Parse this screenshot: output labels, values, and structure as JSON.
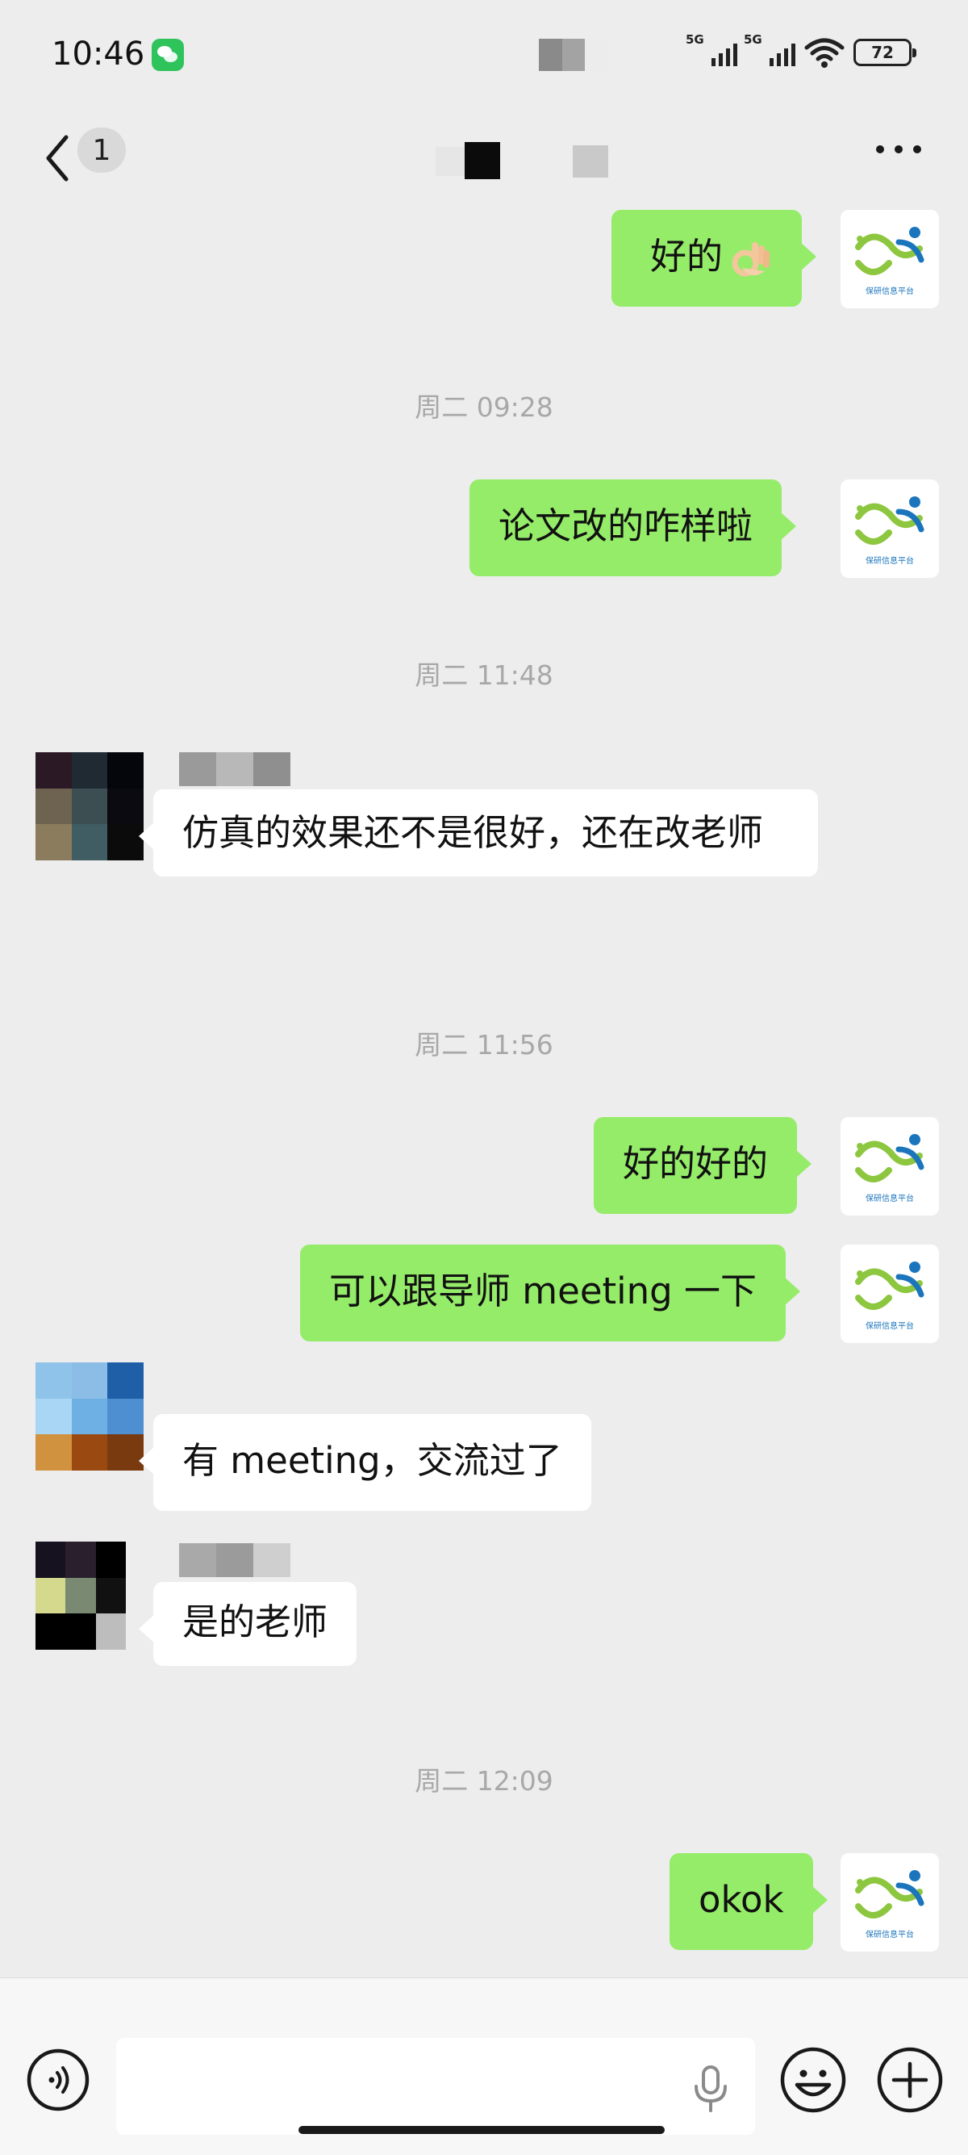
{
  "status_bar": {
    "time": "10:46",
    "signal_1": "5G",
    "signal_2": "5G",
    "battery": "72"
  },
  "nav": {
    "unread_count": "1"
  },
  "messages": [
    {
      "type": "outgoing",
      "text": "好的",
      "emoji": "ok-hand"
    },
    {
      "type": "time",
      "text": "周二 09:28"
    },
    {
      "type": "outgoing",
      "text": "论文改的咋样啦"
    },
    {
      "type": "time",
      "text": "周二 11:48"
    },
    {
      "type": "incoming",
      "text": "仿真的效果还不是很好，还在改老师"
    },
    {
      "type": "time",
      "text": "周二 11:56"
    },
    {
      "type": "outgoing",
      "text": "好的好的"
    },
    {
      "type": "outgoing",
      "text": "可以跟导师 meeting 一下"
    },
    {
      "type": "incoming",
      "text": "有 meeting，交流过了"
    },
    {
      "type": "incoming",
      "text": "是的老师"
    },
    {
      "type": "time",
      "text": "周二 12:09"
    },
    {
      "type": "outgoing",
      "text": "okok"
    }
  ],
  "self_avatar": {
    "caption": "保研信息平台",
    "colors": {
      "green": "#8dc63f",
      "blue": "#1b75bc"
    }
  },
  "input": {
    "value": "",
    "placeholder": ""
  },
  "colors": {
    "background": "#ededed",
    "outgoing_bubble": "#95ec69",
    "incoming_bubble": "#ffffff",
    "timestamp_text": "#a8a8a8"
  }
}
